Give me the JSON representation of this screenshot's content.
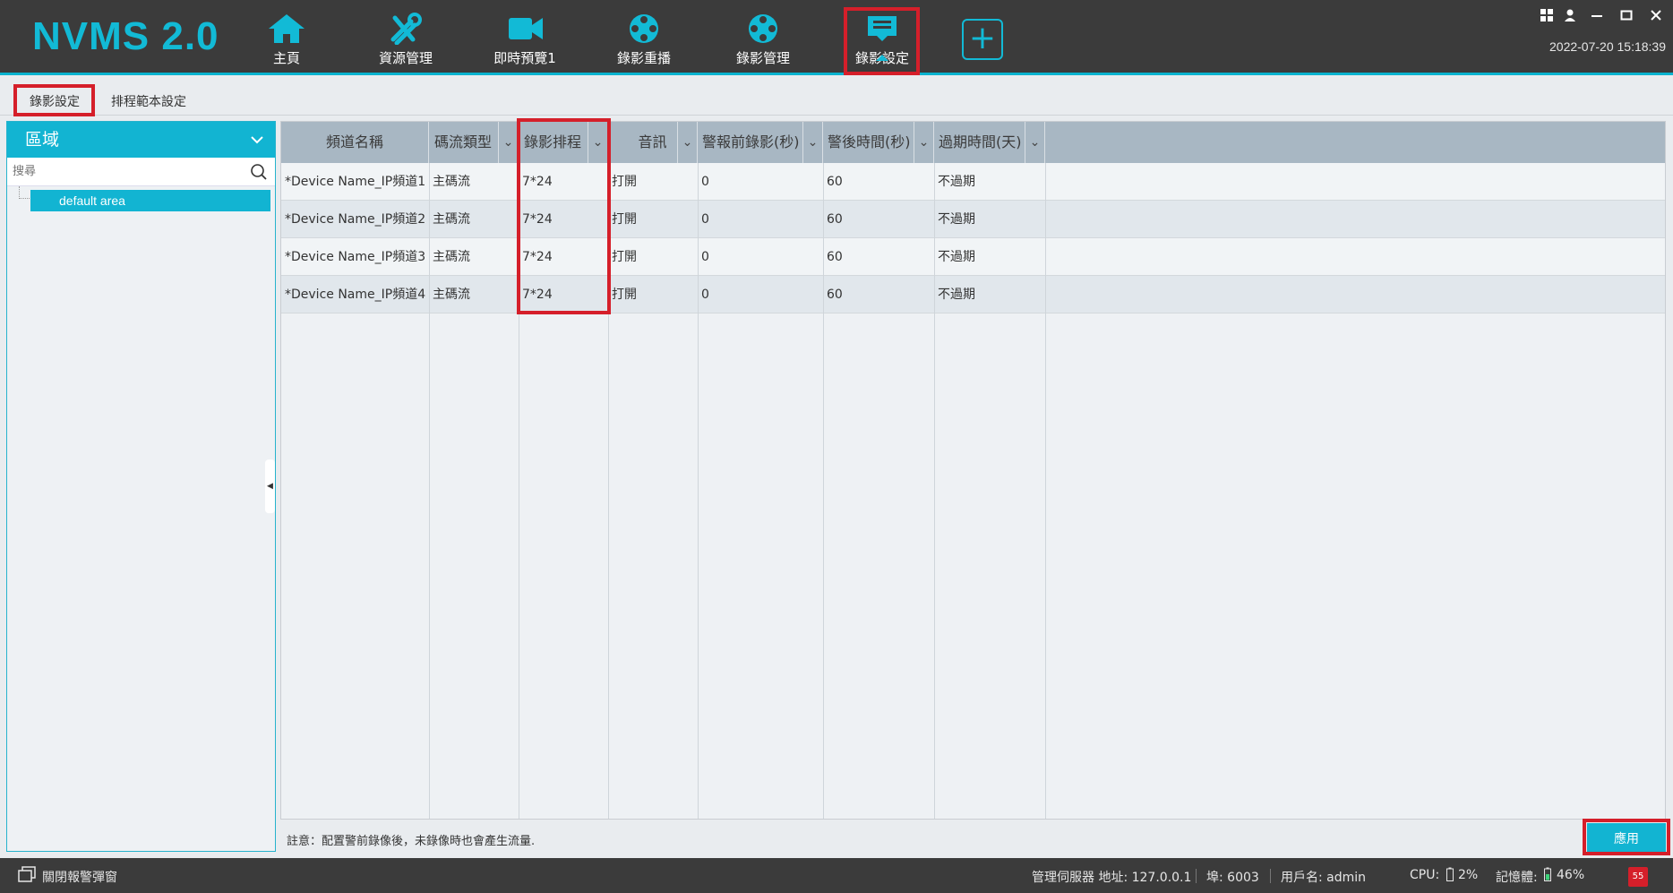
{
  "app": {
    "logo": "NVMS 2.0"
  },
  "nav": [
    {
      "label": "主頁",
      "icon": "home-icon"
    },
    {
      "label": "資源管理",
      "icon": "tools-icon"
    },
    {
      "label": "即時預覽1",
      "icon": "camera-icon"
    },
    {
      "label": "錄影重播",
      "icon": "film-reel-icon"
    },
    {
      "label": "錄影管理",
      "icon": "film-reel-icon"
    },
    {
      "label": "錄影設定",
      "icon": "record-settings-icon",
      "active": true
    }
  ],
  "add_tab": "+",
  "window": {
    "datetime": "2022-07-20 15:18:39"
  },
  "subtabs": [
    "錄影設定",
    "排程範本設定"
  ],
  "sidebar": {
    "title": "區域",
    "search_placeholder": "搜尋",
    "items": [
      "default area"
    ]
  },
  "table": {
    "columns": [
      "頻道名稱",
      "碼流類型",
      "錄影排程",
      "音訊",
      "警報前錄影(秒)",
      "警後時間(秒)",
      "過期時間(天)"
    ],
    "rows": [
      [
        "*Device Name_IP頻道1",
        "主碼流",
        "7*24",
        "打開",
        "0",
        "60",
        "不過期"
      ],
      [
        "*Device Name_IP頻道2",
        "主碼流",
        "7*24",
        "打開",
        "0",
        "60",
        "不過期"
      ],
      [
        "*Device Name_IP頻道3",
        "主碼流",
        "7*24",
        "打開",
        "0",
        "60",
        "不過期"
      ],
      [
        "*Device Name_IP頻道4",
        "主碼流",
        "7*24",
        "打開",
        "0",
        "60",
        "不過期"
      ]
    ]
  },
  "note": "註意：配置警前錄像後，未錄像時也會產生流量.",
  "apply_label": "應用",
  "statusbar": {
    "close_alarm_popup": "關閉報警彈窗",
    "server": "管理伺服器 地址: 127.0.0.1",
    "port": "埠: 6003",
    "user": "用戶名: admin",
    "cpu_label": "CPU:",
    "cpu_value": "2%",
    "mem_label": "記憶體:",
    "mem_value": "46%",
    "alarm_count": "55"
  },
  "colors": {
    "accent": "#12b4d2",
    "highlight": "#d51f2a",
    "topbar": "#3b3b3b"
  }
}
